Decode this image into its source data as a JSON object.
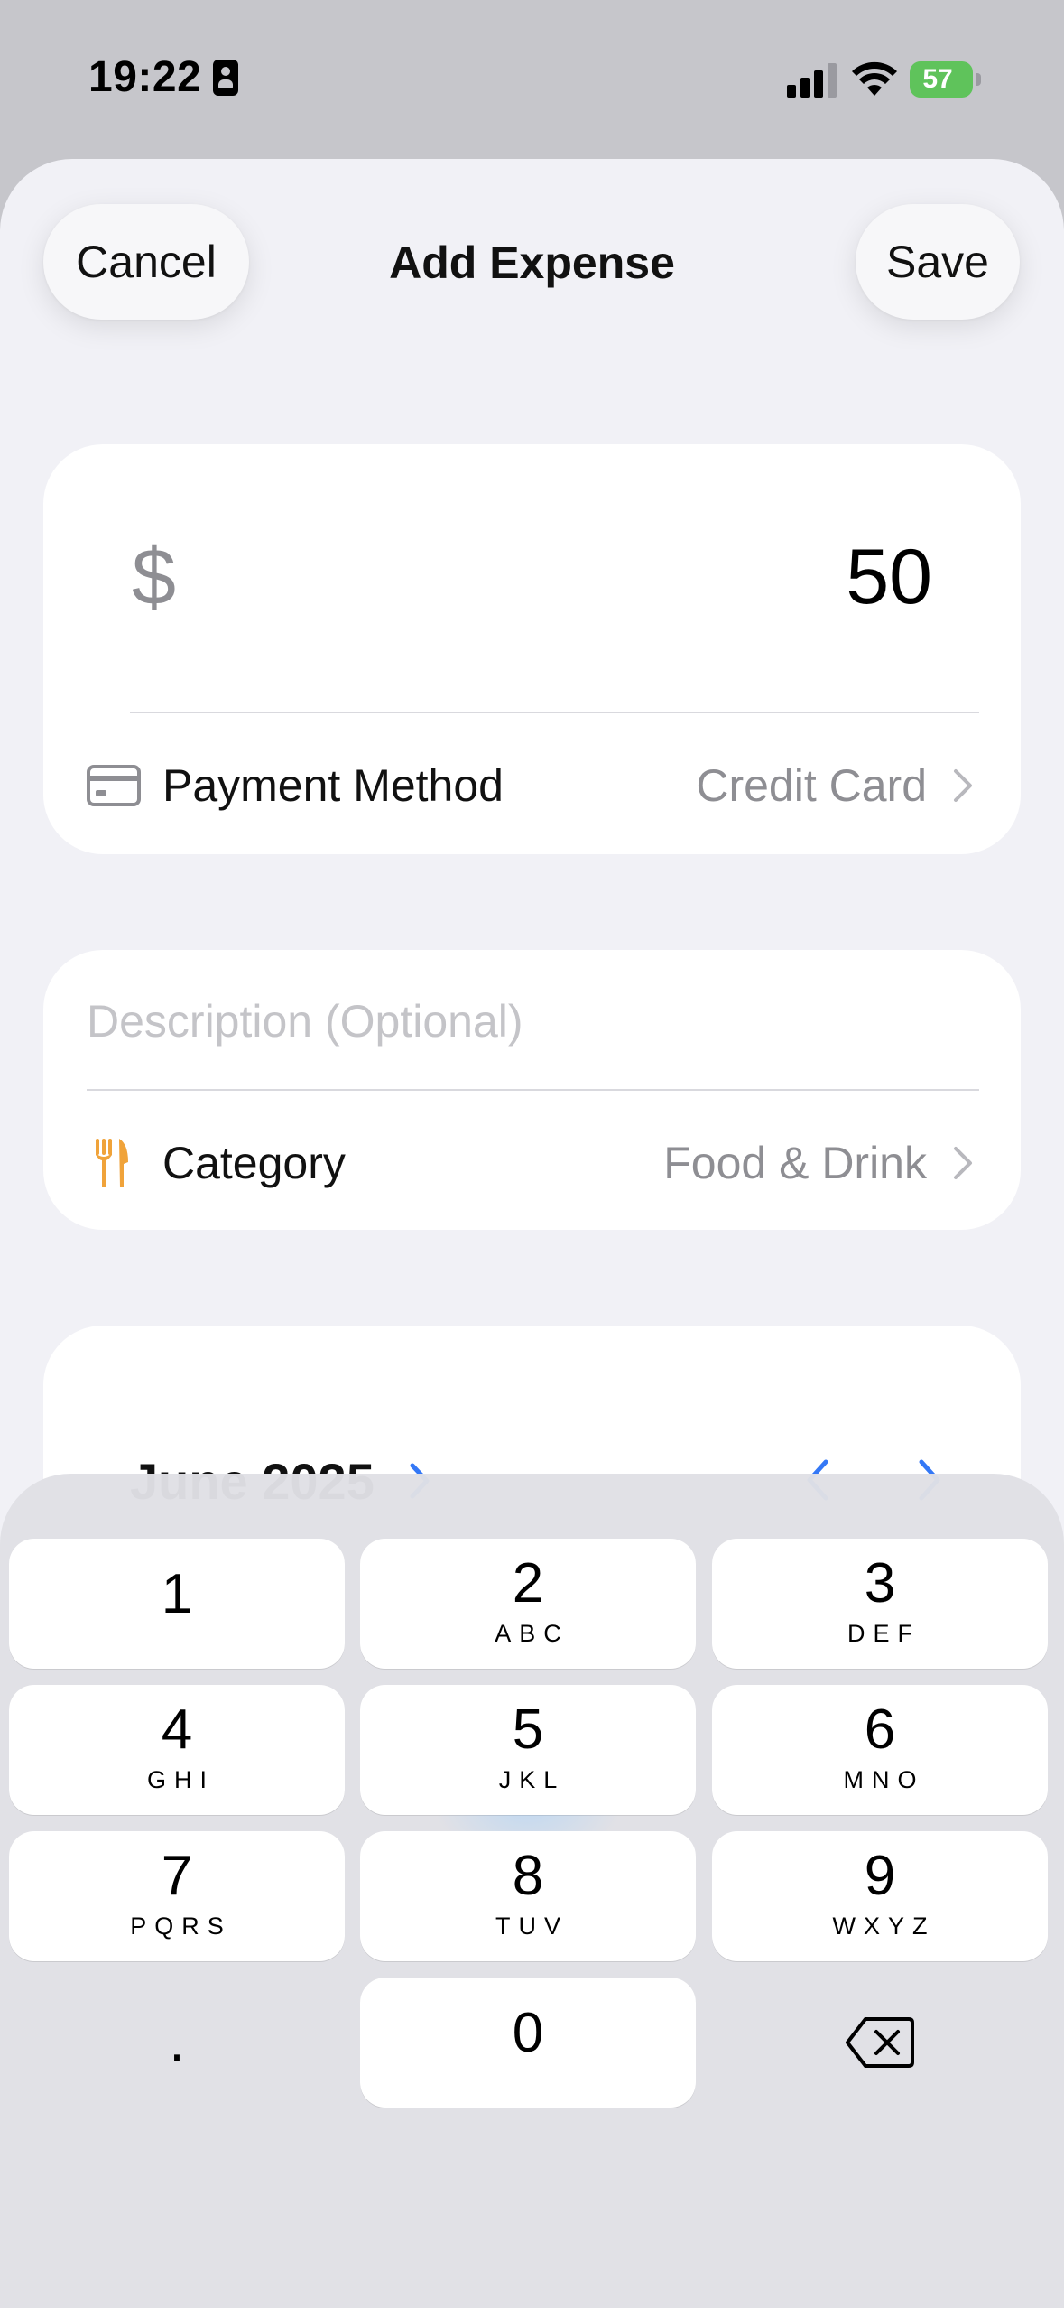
{
  "status_bar": {
    "time": "19:22",
    "battery": "57",
    "icons": [
      "id-card-icon",
      "cellular-signal-icon",
      "wifi-icon",
      "battery-charging-icon"
    ]
  },
  "header": {
    "cancel_label": "Cancel",
    "title": "Add Expense",
    "save_label": "Save"
  },
  "amount_card": {
    "currency_symbol": "$",
    "amount": "50",
    "payment_method": {
      "label": "Payment Method",
      "value": "Credit Card",
      "icon": "credit-card-icon"
    }
  },
  "details_card": {
    "description_placeholder": "Description (Optional)",
    "category": {
      "label": "Category",
      "value": "Food & Drink",
      "icon": "fork-knife-icon",
      "icon_color": "#f0a33a"
    }
  },
  "date_card": {
    "month_label": "June 2025"
  },
  "keypad": {
    "keys": [
      {
        "digit": "1",
        "letters": ""
      },
      {
        "digit": "2",
        "letters": "ABC"
      },
      {
        "digit": "3",
        "letters": "DEF"
      },
      {
        "digit": "4",
        "letters": "GHI"
      },
      {
        "digit": "5",
        "letters": "JKL"
      },
      {
        "digit": "6",
        "letters": "MNO"
      },
      {
        "digit": "7",
        "letters": "PQRS"
      },
      {
        "digit": "8",
        "letters": "TUV"
      },
      {
        "digit": "9",
        "letters": "WXYZ"
      },
      {
        "digit": "0",
        "letters": ""
      }
    ],
    "decimal_label": ".",
    "delete_icon": "backspace-icon"
  },
  "colors": {
    "accent": "#3478f6",
    "battery_green": "#5fc35b",
    "secondary_text": "#8e8e93"
  }
}
